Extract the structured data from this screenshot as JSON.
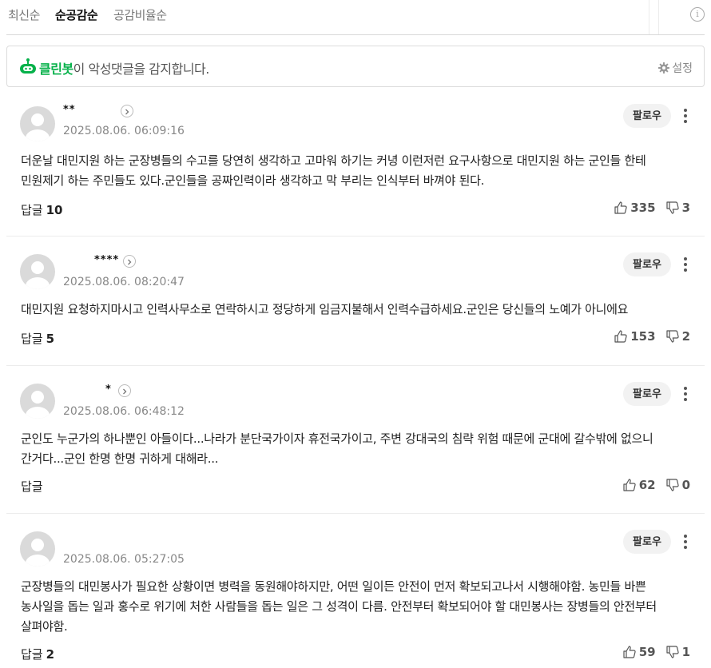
{
  "sort": {
    "tabs": [
      "최신순",
      "순공감순",
      "공감비율순"
    ],
    "active_index": 1
  },
  "info_icon_glyph": "i",
  "cleanbot": {
    "brand": "클린봇",
    "message": "이 악성댓글을 감지합니다.",
    "settings_label": "설정",
    "brand_color": "#06b14a"
  },
  "comments": [
    {
      "author": "** ",
      "date": "2025.08.06. 06:09:16",
      "follow_label": "팔로우",
      "text": "더운날 대민지원 하는 군장병들의 수고를 당연히 생각하고 고마워 하기는 커녕 이런저런 요구사항으로 대민지원 하는 군인들 한테 민원제기 하는 주민들도 있다.군인들을 공짜인력이라 생각하고 막 부리는 인식부터 바껴야 된다.",
      "reply_label": "답글",
      "reply_count": "10",
      "likes": "335",
      "dislikes": "3"
    },
    {
      "author": "****",
      "date": "2025.08.06. 08:20:47",
      "follow_label": "팔로우",
      "text": "대민지원 요청하지마시고 인력사무소로 연락하시고 정당하게 임금지불해서 인력수급하세요.군인은 당신들의 노예가 아니에요",
      "reply_label": "답글",
      "reply_count": "5",
      "likes": "153",
      "dislikes": "2"
    },
    {
      "author": "*",
      "date": "2025.08.06. 06:48:12",
      "follow_label": "팔로우",
      "text": "군인도 누군가의 하나뿐인 아들이다...나라가 분단국가이자 휴전국가이고, 주변 강대국의 침략 위험 때문에 군대에 갈수밖에 없으니 간거다...군인 한명 한명 귀하게 대해라...",
      "reply_label": "답글",
      "reply_count": "",
      "likes": "62",
      "dislikes": "0"
    },
    {
      "author": "",
      "date": "2025.08.06. 05:27:05",
      "follow_label": "팔로우",
      "text": "군장병들의 대민봉사가 필요한 상황이면 병력을 동원해야하지만, 어떤 일이든 안전이 먼저 확보되고나서 시행해야함. 농민들 바쁜 농사일을 돕는 일과 홍수로 위기에 처한 사람들을 돕는 일은 그 성격이 다름. 안전부터 확보되어야 할 대민봉사는 장병들의 안전부터 살펴야함.",
      "reply_label": "답글",
      "reply_count": "2",
      "likes": "59",
      "dislikes": "1"
    }
  ]
}
